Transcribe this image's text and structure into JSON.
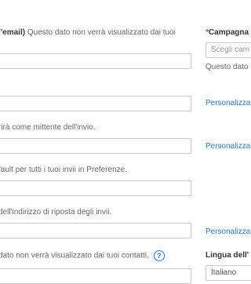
{
  "left_column": {
    "from_email_help_bold": "l'email)",
    "from_email_help": " Questo dato non verrà visualizzato dai tuoi",
    "sender_help": "rirà come mittente dell'invio.",
    "default_help": "fault per tutti i tuoi invii in Preferenze.",
    "reply_help": "dell'indirizzo di riposta degli invii.",
    "contacts_help": "dato non verrà visualizzato dai tuoi contatti."
  },
  "right_column": {
    "campaign_required_mark": "*",
    "campaign_label": "Campagna",
    "campaign_select_placeholder": "Scegli cam",
    "campaign_note": "Questo dato",
    "personalize_link_1": "Personalizza",
    "personalize_link_2": "Personalizza",
    "personalize_link_3": "Personalizza",
    "language_label": "Lingua dell'",
    "language_selected": "Italiano"
  }
}
